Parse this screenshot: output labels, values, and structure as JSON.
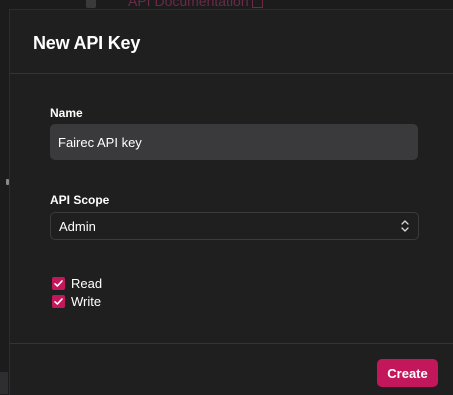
{
  "background": {
    "link_text": "API Documentation"
  },
  "modal": {
    "title": "New API Key",
    "name_field": {
      "label": "Name",
      "value": "Fairec API key"
    },
    "scope_field": {
      "label": "API Scope",
      "selected": "Admin",
      "icon": "chevron-up-down-icon"
    },
    "permissions": [
      {
        "label": "Read",
        "checked": true
      },
      {
        "label": "Write",
        "checked": true
      }
    ],
    "create_label": "Create"
  },
  "colors": {
    "accent": "#c2185b",
    "modal_bg": "#1f1f20",
    "input_bg": "#3a3a3c",
    "divider": "#353537"
  }
}
